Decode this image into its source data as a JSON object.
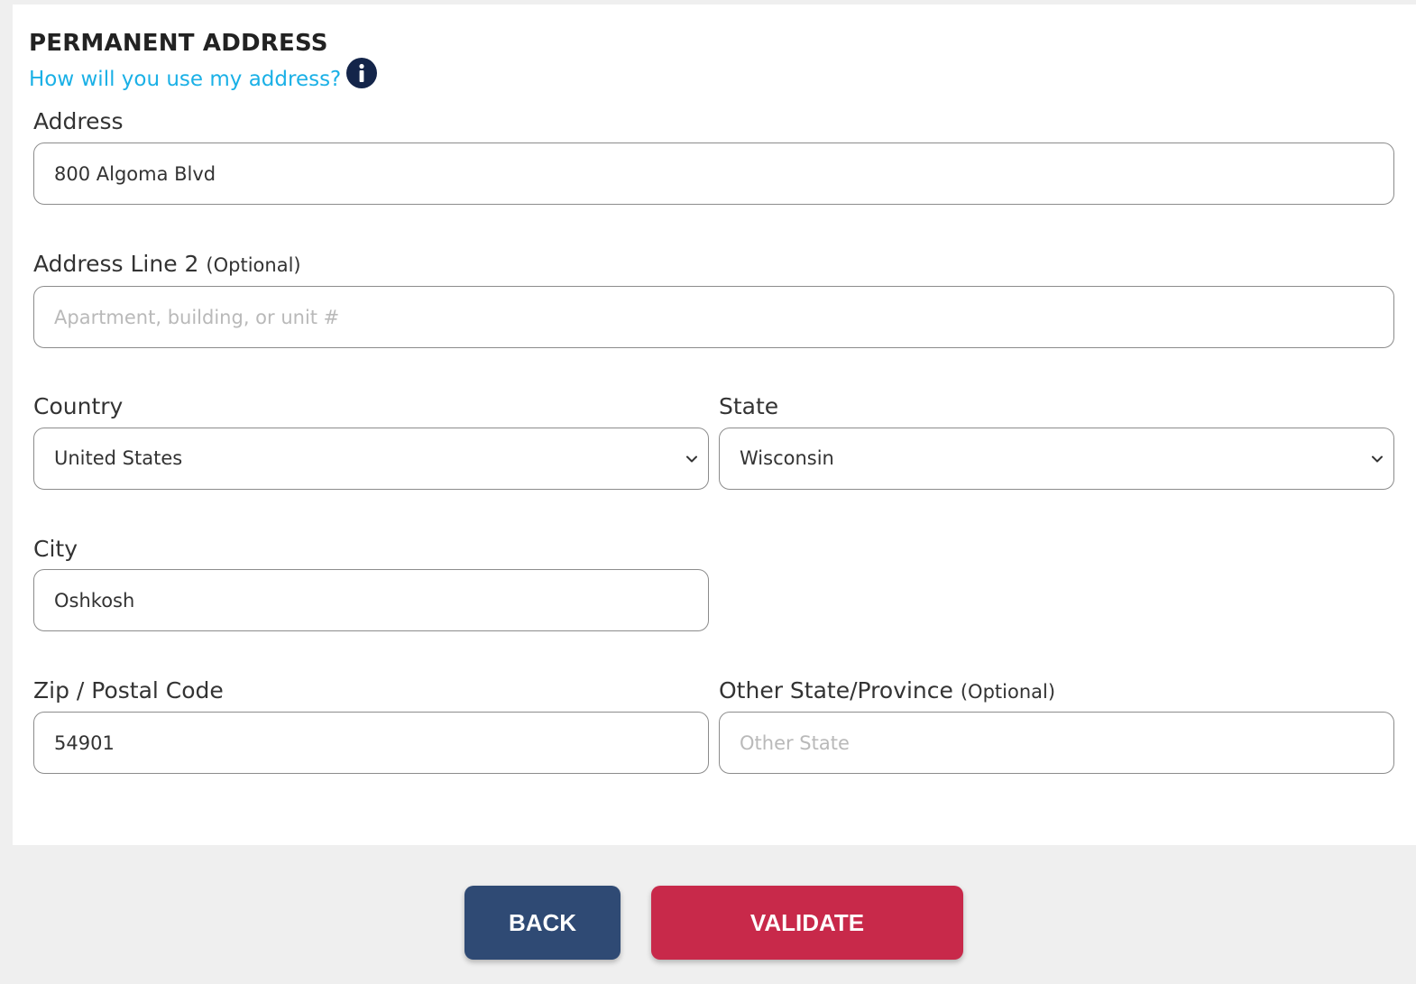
{
  "section": {
    "title": "PERMANENT ADDRESS",
    "help_link": "How will you use my address?",
    "info_icon": "info-icon"
  },
  "fields": {
    "address": {
      "label": "Address",
      "value": "800 Algoma Blvd"
    },
    "address2": {
      "label": "Address Line 2",
      "optional": "(Optional)",
      "value": "",
      "placeholder": "Apartment, building, or unit #"
    },
    "country": {
      "label": "Country",
      "selected": "United States",
      "icon": "chevron-down-icon"
    },
    "state": {
      "label": "State",
      "selected": "Wisconsin",
      "icon": "chevron-down-icon"
    },
    "city": {
      "label": "City",
      "value": "Oshkosh"
    },
    "zip": {
      "label": "Zip / Postal Code",
      "value": "54901"
    },
    "other_state": {
      "label": "Other State/Province",
      "optional": "(Optional)",
      "value": "",
      "placeholder": "Other State"
    }
  },
  "actions": {
    "back_label": "BACK",
    "validate_label": "VALIDATE"
  },
  "colors": {
    "link": "#1ab0e6",
    "info_icon": "#14254a",
    "back_button": "#2f4a74",
    "validate_button": "#c8294a",
    "footer_bg": "#efefef",
    "card_bg": "#ffffff"
  }
}
